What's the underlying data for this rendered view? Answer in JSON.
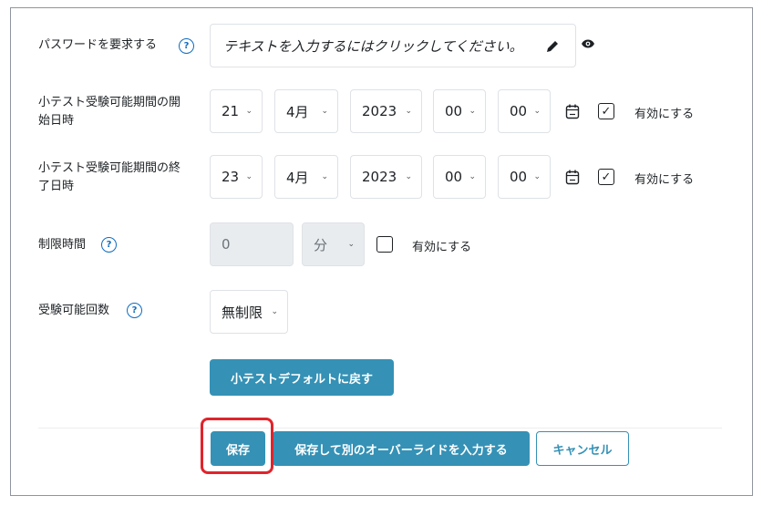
{
  "password": {
    "label": "パスワードを要求する",
    "placeholder": "テキストを入力するにはクリックしてください。"
  },
  "open_date": {
    "label_line1": "小テスト受験可能期間の開",
    "label_line2": "始日時",
    "day": "21",
    "month": "4月",
    "year": "2023",
    "hour": "00",
    "minute": "00",
    "enable_label": "有効にする",
    "enabled": true
  },
  "close_date": {
    "label_line1": "小テスト受験可能期間の終",
    "label_line2": "了日時",
    "day": "23",
    "month": "4月",
    "year": "2023",
    "hour": "00",
    "minute": "00",
    "enable_label": "有効にする",
    "enabled": true
  },
  "time_limit": {
    "label": "制限時間",
    "value": "0",
    "unit": "分",
    "enable_label": "有効にする",
    "enabled": false
  },
  "attempts": {
    "label": "受験可能回数",
    "value": "無制限"
  },
  "help_glyph": "?",
  "revert_button": "小テストデフォルトに戻す",
  "footer": {
    "save": "保存",
    "save_and_next": "保存して別のオーバーライドを入力する",
    "cancel": "キャンセル"
  },
  "icons": {
    "help": "question-circle-icon",
    "edit": "pencil-icon",
    "visibility": "eye-icon",
    "calendar": "calendar-icon",
    "dropdown": "chevron-down-icon",
    "checkbox": "checkmark-icon"
  },
  "colors": {
    "primary": "#3591b5",
    "help": "#0f6cbf",
    "highlight": "#e0242b"
  }
}
